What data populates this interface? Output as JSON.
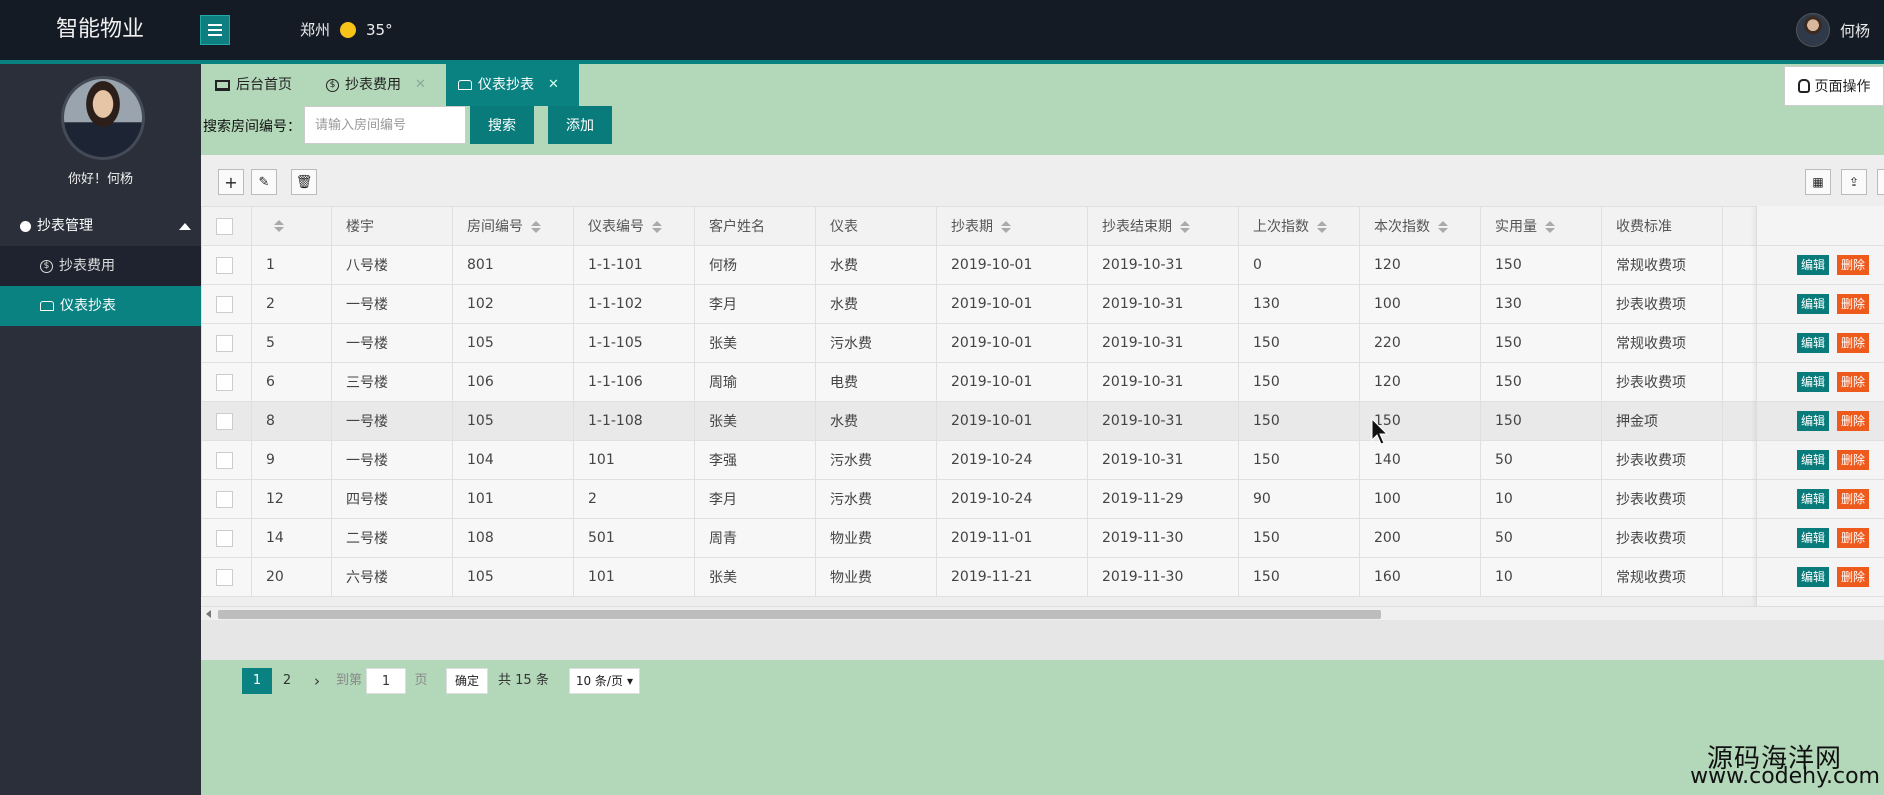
{
  "header": {
    "logo": "智能物业",
    "city": "郑州",
    "temp": "35°",
    "username": "何杨"
  },
  "sidebar": {
    "greeting": "你好！何杨",
    "group": "抄表管理",
    "items": [
      {
        "label": "抄表费用"
      },
      {
        "label": "仪表抄表"
      }
    ]
  },
  "tabs": [
    {
      "label": "后台首页"
    },
    {
      "label": "抄表费用"
    },
    {
      "label": "仪表抄表"
    }
  ],
  "page_ops": "页面操作",
  "search": {
    "label": "搜索房间编号：",
    "placeholder": "请输入房间编号",
    "search_btn": "搜索",
    "add_btn": "添加"
  },
  "table": {
    "headers": [
      "",
      "",
      "楼宇",
      "房间编号",
      "仪表编号",
      "客户姓名",
      "仪表",
      "抄表期",
      "抄表结束期",
      "上次指数",
      "本次指数",
      "实用量",
      "收费标准",
      ""
    ],
    "rows": [
      [
        "1",
        "八号楼",
        "801",
        "1-1-101",
        "何杨",
        "水费",
        "2019-10-01",
        "2019-10-31",
        "0",
        "120",
        "150",
        "常规收费项"
      ],
      [
        "2",
        "一号楼",
        "102",
        "1-1-102",
        "李月",
        "水费",
        "2019-10-01",
        "2019-10-31",
        "130",
        "100",
        "130",
        "抄表收费项"
      ],
      [
        "5",
        "一号楼",
        "105",
        "1-1-105",
        "张美",
        "污水费",
        "2019-10-01",
        "2019-10-31",
        "150",
        "220",
        "150",
        "常规收费项"
      ],
      [
        "6",
        "三号楼",
        "106",
        "1-1-106",
        "周瑜",
        "电费",
        "2019-10-01",
        "2019-10-31",
        "150",
        "120",
        "150",
        "抄表收费项"
      ],
      [
        "8",
        "一号楼",
        "105",
        "1-1-108",
        "张美",
        "水费",
        "2019-10-01",
        "2019-10-31",
        "150",
        "150",
        "150",
        "押金项"
      ],
      [
        "9",
        "一号楼",
        "104",
        "101",
        "李强",
        "污水费",
        "2019-10-24",
        "2019-10-31",
        "150",
        "140",
        "50",
        "抄表收费项"
      ],
      [
        "12",
        "四号楼",
        "101",
        "2",
        "李月",
        "污水费",
        "2019-10-24",
        "2019-11-29",
        "90",
        "100",
        "10",
        "抄表收费项"
      ],
      [
        "14",
        "二号楼",
        "108",
        "501",
        "周青",
        "物业费",
        "2019-11-01",
        "2019-11-30",
        "150",
        "200",
        "50",
        "抄表收费项"
      ],
      [
        "20",
        "六号楼",
        "105",
        "101",
        "张美",
        "物业费",
        "2019-11-21",
        "2019-11-30",
        "150",
        "160",
        "10",
        "常规收费项"
      ]
    ],
    "edit_label": "编辑",
    "delete_label": "删除"
  },
  "pager": {
    "pages": [
      "1",
      "2"
    ],
    "goto_label": "到第",
    "goto_value": "1",
    "page_label": "页",
    "confirm": "确定",
    "total": "共 15 条",
    "page_size": "10 条/页"
  },
  "watermark": {
    "line1": "源码海洋网",
    "line2": "www.codehy.com"
  },
  "colors": {
    "accent": "#0a8282",
    "header_bg": "#151b25",
    "sidebar_bg": "#2b2f3a",
    "content_bg": "#b3d8b9",
    "delete": "#ee5a1c"
  }
}
